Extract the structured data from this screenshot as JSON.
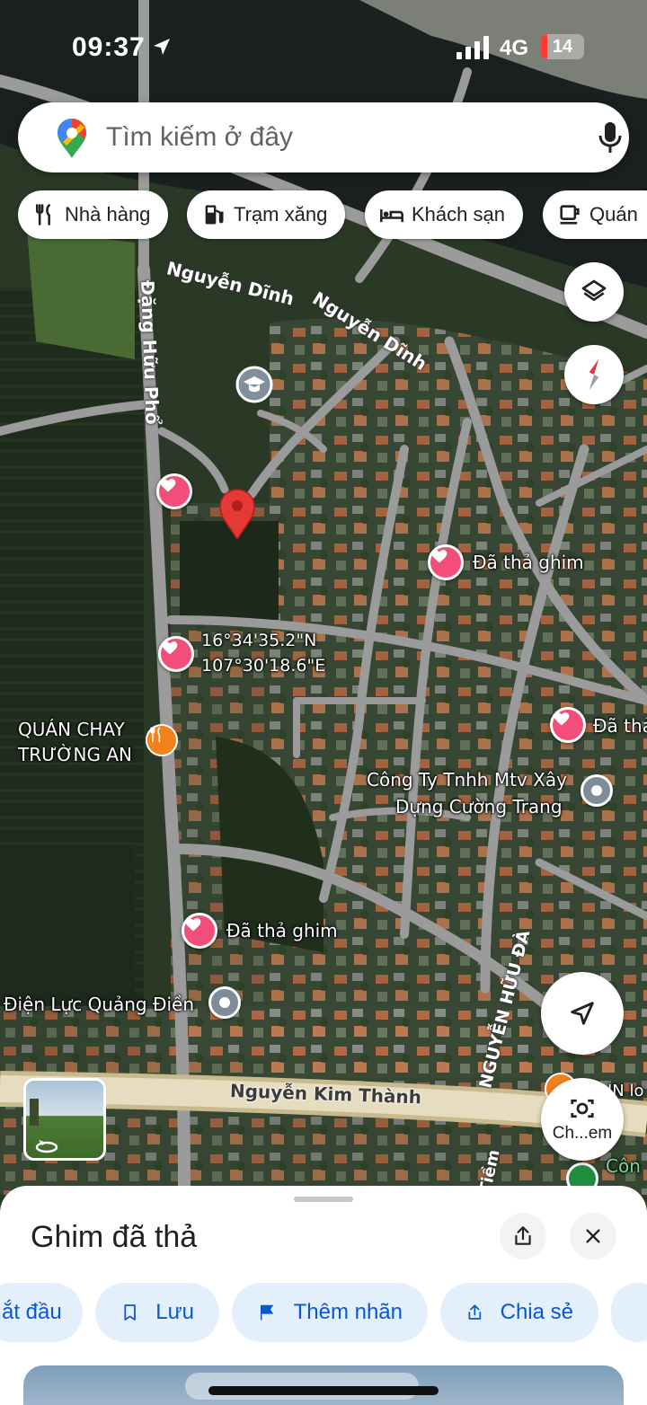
{
  "status_bar": {
    "time": "09:37",
    "network": "4G",
    "battery": "14",
    "battery_level_percent": 14
  },
  "search": {
    "placeholder": "Tìm kiếm ở đây"
  },
  "chips": [
    {
      "label": "Nhà hàng",
      "icon": "fork-knife-icon"
    },
    {
      "label": "Trạm xăng",
      "icon": "gas-station-icon"
    },
    {
      "label": "Khách sạn",
      "icon": "bed-icon"
    },
    {
      "label": "Quán",
      "icon": "coffee-cup-icon"
    }
  ],
  "map": {
    "roads": {
      "nguyen_dinh_1": "Nguyễn Dĩnh",
      "nguyen_dinh_2": "Nguyễn Dĩnh",
      "dang_huu_pho": "Đặng Hữu Phổ",
      "nguyen_huu_da": "NGUYỄN HỮU ĐÀ",
      "nguyen_kim_thanh": "Nguyễn Kim Thành",
      "tiem": "Tiềm"
    },
    "coordinates": {
      "lat": "16°34'35.2\"N",
      "lng": "107°30'18.6\"E"
    },
    "saved_pin_label": "Đã thả ghim",
    "saved_pin_label_cut": "Đã thả",
    "places": {
      "quan_chay_line1": "QUÁN CHAY",
      "quan_chay_line2": "TRƯỜNG AN",
      "company_line1": "Công Ty Tnhh Mtv Xây",
      "company_line2": "Dựng Cường Trang",
      "dien_luc": "Điện Lực Quảng Điền",
      "con_partial": "Côn",
      "in_partial": "IN lo"
    },
    "lens_label": "Ch...em",
    "colors": {
      "pin_red": "#e53935",
      "heart_pink": "#f24e79",
      "road_grey": "#9b9b9b"
    }
  },
  "sheet": {
    "title": "Ghim đã thả",
    "actions": [
      {
        "label": "ắt đầu",
        "icon": "directions-icon"
      },
      {
        "label": "Lưu",
        "icon": "bookmark-icon"
      },
      {
        "label": "Thêm nhãn",
        "icon": "flag-icon"
      },
      {
        "label": "Chia sẻ",
        "icon": "share-icon"
      },
      {
        "label": "",
        "icon": "download-icon"
      }
    ]
  }
}
